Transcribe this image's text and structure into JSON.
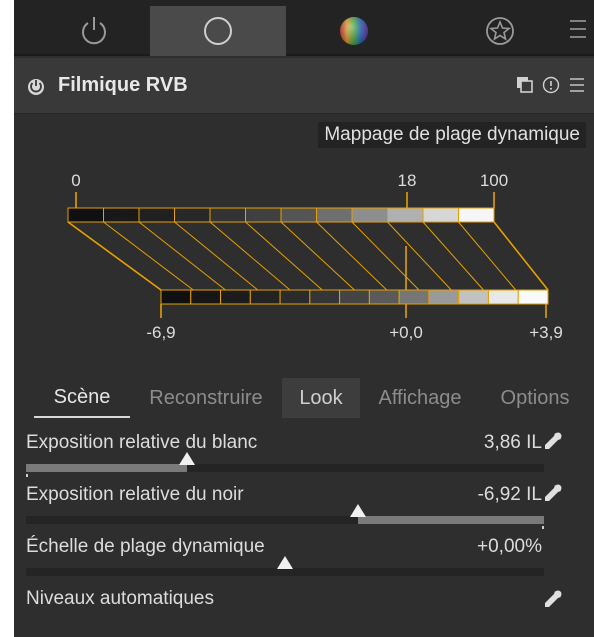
{
  "module": {
    "title": "Filmique RVB"
  },
  "graph": {
    "title": "Mappage de plage dynamique",
    "top_labels": [
      "0",
      "18",
      "100"
    ],
    "bottom_labels": [
      "-6,9",
      "+0,0",
      "+3,9"
    ]
  },
  "tabs": [
    {
      "label": "Scène",
      "active": true
    },
    {
      "label": "Reconstruire",
      "active": false
    },
    {
      "label": "Look",
      "active": false
    },
    {
      "label": "Affichage",
      "active": false
    },
    {
      "label": "Options",
      "active": false
    }
  ],
  "sliders": [
    {
      "label": "Exposition relative du blanc",
      "value": "3,86 IL",
      "position": 0.31
    },
    {
      "label": "Exposition relative du noir",
      "value": "-6,92 IL",
      "position": 0.64
    },
    {
      "label": "Échelle de plage dynamique",
      "value": "+0,00%",
      "position": 0.5
    }
  ],
  "auto_levels": {
    "label": "Niveaux automatiques"
  },
  "colors": {
    "accent": "#e6a000",
    "panel": "#2e2e2e",
    "header": "#393939"
  }
}
